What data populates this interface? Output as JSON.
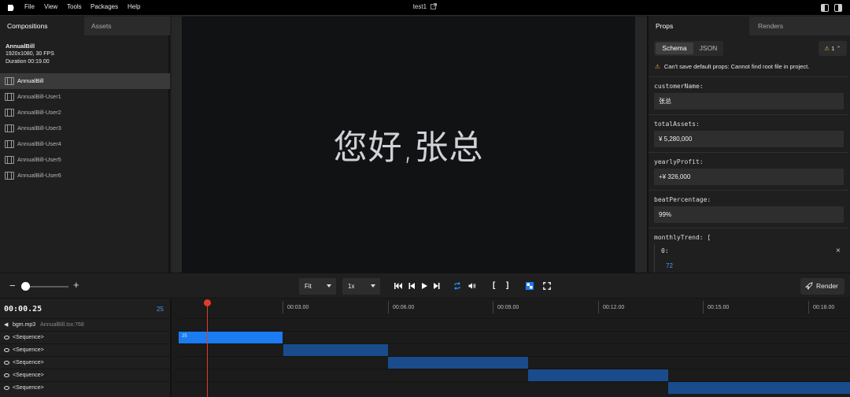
{
  "menubar": {
    "items": [
      "File",
      "View",
      "Tools",
      "Packages",
      "Help"
    ],
    "title": "test1"
  },
  "left_panel": {
    "tabs": [
      "Compositions",
      "Assets"
    ],
    "composition": {
      "name": "AnnualBill",
      "resolution": "1920x1080, 30 FPS",
      "duration": "Duration 00:19.00"
    },
    "items": [
      "AnnualBill",
      "AnnualBill-User1",
      "AnnualBill-User2",
      "AnnualBill-User3",
      "AnnualBill-User4",
      "AnnualBill-User5",
      "AnnualBill-User6"
    ]
  },
  "canvas": {
    "text": "您好,张总"
  },
  "right_panel": {
    "tabs": [
      "Props",
      "Renders"
    ],
    "segment": [
      "Schema",
      "JSON"
    ],
    "warning_count": "1",
    "warning_message": "Can't save default props: Cannot find root file in project.",
    "fields": [
      {
        "label": "customerName:",
        "value": "张总"
      },
      {
        "label": "totalAssets:",
        "value": "¥ 5,280,000"
      },
      {
        "label": "yearlyProfit:",
        "value": "+¥ 326,000"
      },
      {
        "label": "beatPercentage:",
        "value": "99%"
      }
    ],
    "trend": {
      "label": "monthlyTrend: [",
      "index": "0:",
      "value": "72"
    }
  },
  "controls": {
    "zoom_level": 0.0,
    "fit_select": "Fit",
    "speed_select": "1x",
    "render_label": "Render"
  },
  "timeline": {
    "time": "00:00.25",
    "frame": "25",
    "ticks": [
      "00:03.00",
      "00:06.00",
      "00:09.00",
      "00:12.00",
      "00:15.00",
      "00:18.00"
    ],
    "audio_track": {
      "name": "bgm.mp3",
      "source": "AnnualBill.tsx:768"
    },
    "sequences": [
      "<Sequence>",
      "<Sequence>",
      "<Sequence>",
      "<Sequence>",
      "<Sequence>"
    ],
    "first_block_label": "25"
  },
  "colors": {
    "accent": "#1a7cf0",
    "seq_dark": "#1a4c8c",
    "playhead": "#e23a2a",
    "warning": "#e8b83a"
  }
}
